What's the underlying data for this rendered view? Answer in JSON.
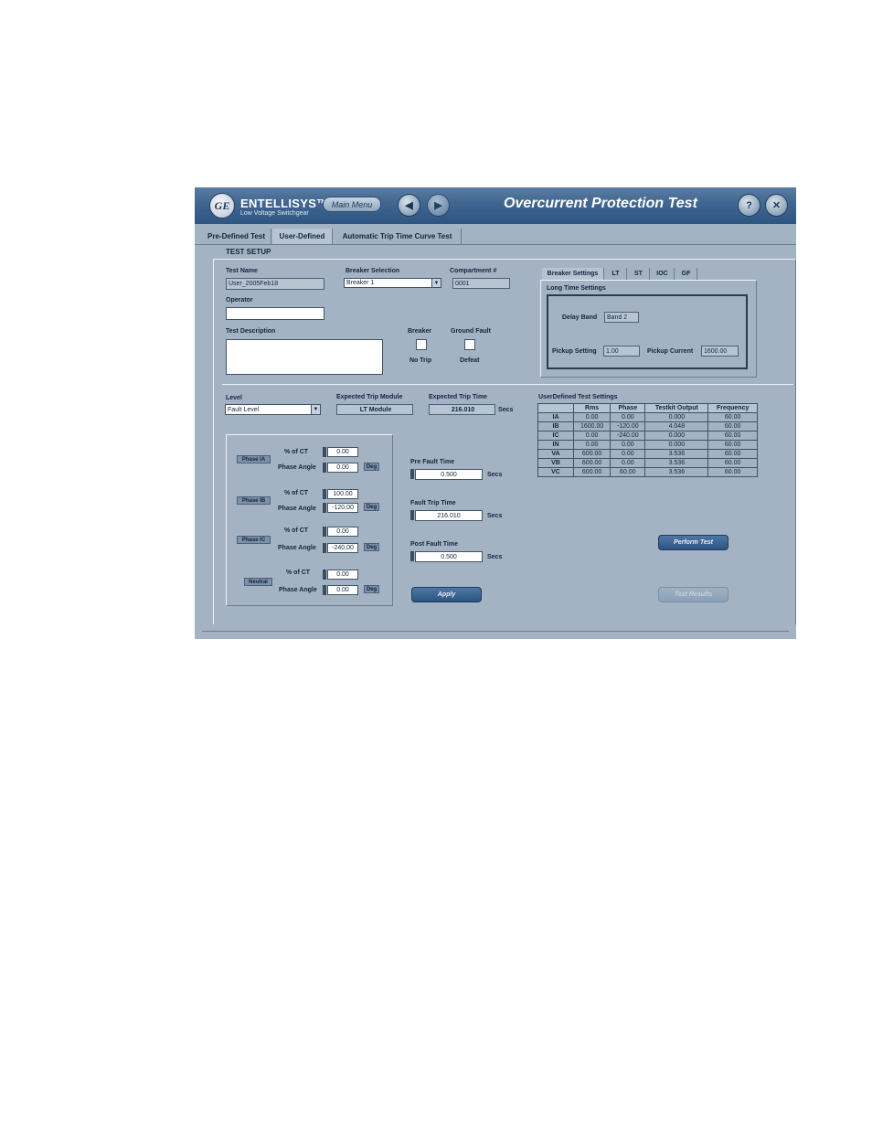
{
  "header": {
    "brand": "ENTELLISYS™",
    "brand_sub": "Low Voltage Switchgear",
    "logo_text": "GE",
    "main_menu_label": "Main Menu",
    "back_glyph": "◀",
    "forward_glyph": "▶",
    "title": "Overcurrent Protection Test",
    "help_glyph": "?",
    "close_glyph": "✕"
  },
  "tabs": [
    {
      "label": "Pre-Defined Test"
    },
    {
      "label": "User-Defined"
    },
    {
      "label": "Automatic Trip Time Curve Test"
    }
  ],
  "test_setup": {
    "title": "TEST SETUP",
    "test_name_label": "Test Name",
    "test_name_value": "User_2005Feb18",
    "breaker_selection_label": "Breaker Selection",
    "breaker_selection_value": "Breaker 1",
    "compartment_label": "Compartment #",
    "compartment_value": "0001",
    "operator_label": "Operator",
    "operator_value": "",
    "test_description_label": "Test Description",
    "test_description_value": "",
    "breaker_label": "Breaker",
    "no_trip_label": "No Trip",
    "ground_fault_label": "Ground Fault",
    "defeat_label": "Defeat"
  },
  "breaker_settings": {
    "tabs": [
      "Breaker Settings",
      "LT",
      "ST",
      "IOC",
      "GF"
    ],
    "group_title": "Long Time Settings",
    "delay_band_label": "Delay Band",
    "delay_band_value": "Band 2",
    "pickup_setting_label": "Pickup Setting",
    "pickup_setting_value": "1.00",
    "pickup_current_label": "Pickup Current",
    "pickup_current_value": "1600.00"
  },
  "level": {
    "label": "Level",
    "value": "Fault Level",
    "expected_module_label": "Expected Trip Module",
    "expected_module_value": "LT Module",
    "expected_time_label": "Expected Trip Time",
    "expected_time_value": "216.010",
    "secs": "Secs"
  },
  "phases": [
    {
      "tag": "Phase IA",
      "pct_label": "% of CT",
      "pct": "0.00",
      "angle_label": "Phase Angle",
      "angle": "0.00",
      "deg": "Deg"
    },
    {
      "tag": "Phase IB",
      "pct_label": "% of CT",
      "pct": "100.00",
      "angle_label": "Phase Angle",
      "angle": "-120.00",
      "deg": "Deg"
    },
    {
      "tag": "Phase IC",
      "pct_label": "% of CT",
      "pct": "0.00",
      "angle_label": "Phase Angle",
      "angle": "-240.00",
      "deg": "Deg"
    },
    {
      "tag": "Neutral",
      "pct_label": "% of CT",
      "pct": "0.00",
      "angle_label": "Phase Angle",
      "angle": "0.00",
      "deg": "Deg"
    }
  ],
  "timing": {
    "pre_fault_label": "Pre Fault Time",
    "pre_fault_value": "0.500",
    "fault_trip_label": "Fault Trip Time",
    "fault_trip_value": "216.010",
    "post_fault_label": "Post Fault Time",
    "post_fault_value": "0.500",
    "secs": "Secs"
  },
  "apply_label": "Apply",
  "perform_test_label": "Perform Test",
  "test_results_label": "Test Results",
  "user_defined_table": {
    "title": "UserDefined Test Settings",
    "columns": [
      "",
      "Rms",
      "Phase",
      "Testkit Output",
      "Frequency"
    ],
    "rows": [
      [
        "IA",
        "0.00",
        "0.00",
        "0.000",
        "60.00"
      ],
      [
        "IB",
        "1600.00",
        "-120.00",
        "4.048",
        "60.00"
      ],
      [
        "IC",
        "0.00",
        "-240.00",
        "0.000",
        "60.00"
      ],
      [
        "IN",
        "0.00",
        "0.00",
        "0.000",
        "60.00"
      ],
      [
        "VA",
        "600.00",
        "0.00",
        "3.536",
        "60.00"
      ],
      [
        "VB",
        "600.00",
        "0.00",
        "3.536",
        "60.00"
      ],
      [
        "VC",
        "600.00",
        "60.00",
        "3.536",
        "60.00"
      ]
    ]
  }
}
